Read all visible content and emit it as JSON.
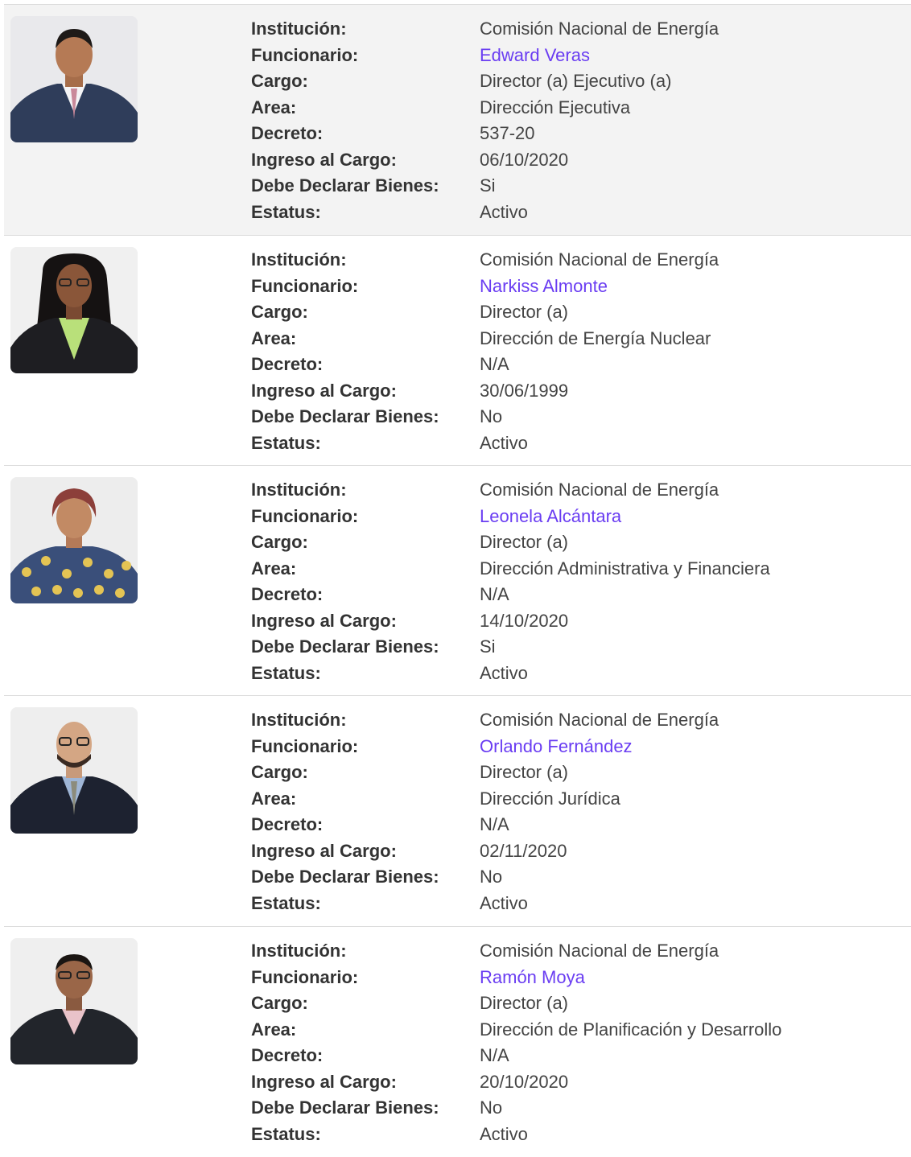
{
  "labels": {
    "institucion": "Institución:",
    "funcionario": "Funcionario:",
    "cargo": "Cargo:",
    "area": "Area:",
    "decreto": "Decreto:",
    "ingreso": "Ingreso al Cargo:",
    "declarar": "Debe Declarar Bienes:",
    "estatus": "Estatus:"
  },
  "colors": {
    "link": "#6a3df2",
    "highlight_bg": "#f3f3f3"
  },
  "officials": [
    {
      "institucion": "Comisión Nacional de Energía",
      "funcionario": "Edward Veras",
      "cargo": "Director (a) Ejecutivo (a)",
      "area": "Dirección Ejecutiva",
      "decreto": "537-20",
      "ingreso": "06/10/2020",
      "declarar": "Si",
      "estatus": "Activo"
    },
    {
      "institucion": "Comisión Nacional de Energía",
      "funcionario": "Narkiss Almonte",
      "cargo": "Director (a)",
      "area": "Dirección de Energía Nuclear",
      "decreto": "N/A",
      "ingreso": "30/06/1999",
      "declarar": "No",
      "estatus": "Activo"
    },
    {
      "institucion": "Comisión Nacional de Energía",
      "funcionario": "Leonela Alcántara",
      "cargo": "Director (a)",
      "area": "Dirección Administrativa y Financiera",
      "decreto": "N/A",
      "ingreso": "14/10/2020",
      "declarar": "Si",
      "estatus": "Activo"
    },
    {
      "institucion": "Comisión Nacional de Energía",
      "funcionario": "Orlando Fernández",
      "cargo": "Director (a)",
      "area": "Dirección Jurídica",
      "decreto": "N/A",
      "ingreso": "02/11/2020",
      "declarar": "No",
      "estatus": "Activo"
    },
    {
      "institucion": "Comisión Nacional de Energía",
      "funcionario": "Ramón Moya",
      "cargo": "Director (a)",
      "area": "Dirección de Planificación y Desarrollo",
      "decreto": "N/A",
      "ingreso": "20/10/2020",
      "declarar": "No",
      "estatus": "Activo"
    }
  ]
}
